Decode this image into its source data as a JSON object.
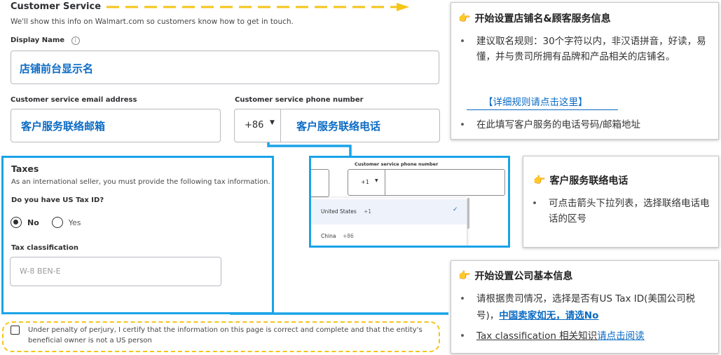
{
  "customer_service": {
    "title": "Customer Service",
    "subtitle": "We'll show this info on Walmart.com so customers know how to get in touch.",
    "display_name_label": "Display Name",
    "display_name_value": "店铺前台显示名",
    "email_label": "Customer service email address",
    "email_value": "客户服务联络邮箱",
    "phone_label": "Customer service phone number",
    "phone_code": "+86",
    "phone_value": "客户服务联络电话"
  },
  "taxes": {
    "title": "Taxes",
    "subtitle": "As an international seller, you must provide the following tax information.",
    "question": "Do you have US Tax ID?",
    "option_no": "No",
    "option_yes": "Yes",
    "classification_label": "Tax classification",
    "classification_placeholder": "W-8 BEN-E"
  },
  "certify_text": "Under penalty of perjury, I certify that the information on this page is correct and complete and that the entity's beneficial owner is not a US person",
  "phone_zoom": {
    "label": "Customer service phone number",
    "code": "+1",
    "options": [
      {
        "country": "United States",
        "code": "+1"
      },
      {
        "country": "China",
        "code": "+86"
      }
    ]
  },
  "card_store": {
    "title": "开始设置店铺名&顾客服务信息",
    "bullet1": "建议取名规则：30个字符以内，非汉语拼音，好读，易懂，并与贵司所拥有品牌和产品相关的店铺名。",
    "link": "【详细规则请点击这里】",
    "bullet2": "在此填写客户服务的电话号码/邮箱地址"
  },
  "card_phone": {
    "title": "客户服务联络电话",
    "bullet": "可点击箭头下拉列表，选择联络电话电话的区号"
  },
  "card_company": {
    "title": "开始设置公司基本信息",
    "bullet1_a": "请根据贵司情况，选择是否有US Tax ID(美国公司税号)，",
    "bullet1_b": "中国卖家如无，请选No",
    "bullet2_a": "Tax classification 相关知识",
    "bullet2_b": "请点击阅读"
  },
  "colors": {
    "accent_yellow": "#f5c518",
    "highlight_blue": "#1aa3e8",
    "link_blue": "#0b6bc4"
  }
}
